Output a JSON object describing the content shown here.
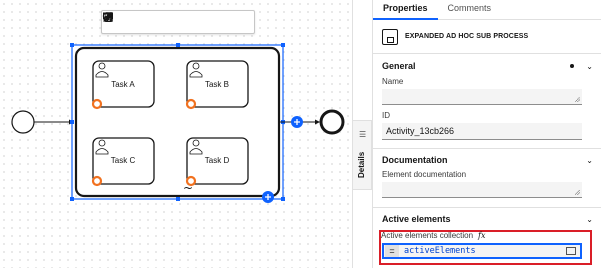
{
  "diagram": {
    "tasks": [
      {
        "label": "Task A"
      },
      {
        "label": "Task B"
      },
      {
        "label": "Task C"
      },
      {
        "label": "Task D"
      }
    ]
  },
  "details_tab": {
    "label": "Details"
  },
  "panel": {
    "tabs": [
      {
        "label": "Properties",
        "active": true
      },
      {
        "label": "Comments",
        "active": false
      }
    ],
    "element_type": "EXPANDED AD HOC SUB PROCESS",
    "general": {
      "title": "General",
      "name_label": "Name",
      "name_value": "",
      "id_label": "ID",
      "id_value": "Activity_13cb266"
    },
    "documentation": {
      "title": "Documentation",
      "label": "Element documentation",
      "value": ""
    },
    "active_elements": {
      "title": "Active elements",
      "collection_label": "Active elements collection",
      "fx": "fx",
      "eq": "=",
      "value": "activeElements"
    }
  },
  "colors": {
    "accent": "#0f62fe",
    "highlight": "#da1e28",
    "marker": "#f1711f",
    "stroke": "#161616"
  }
}
